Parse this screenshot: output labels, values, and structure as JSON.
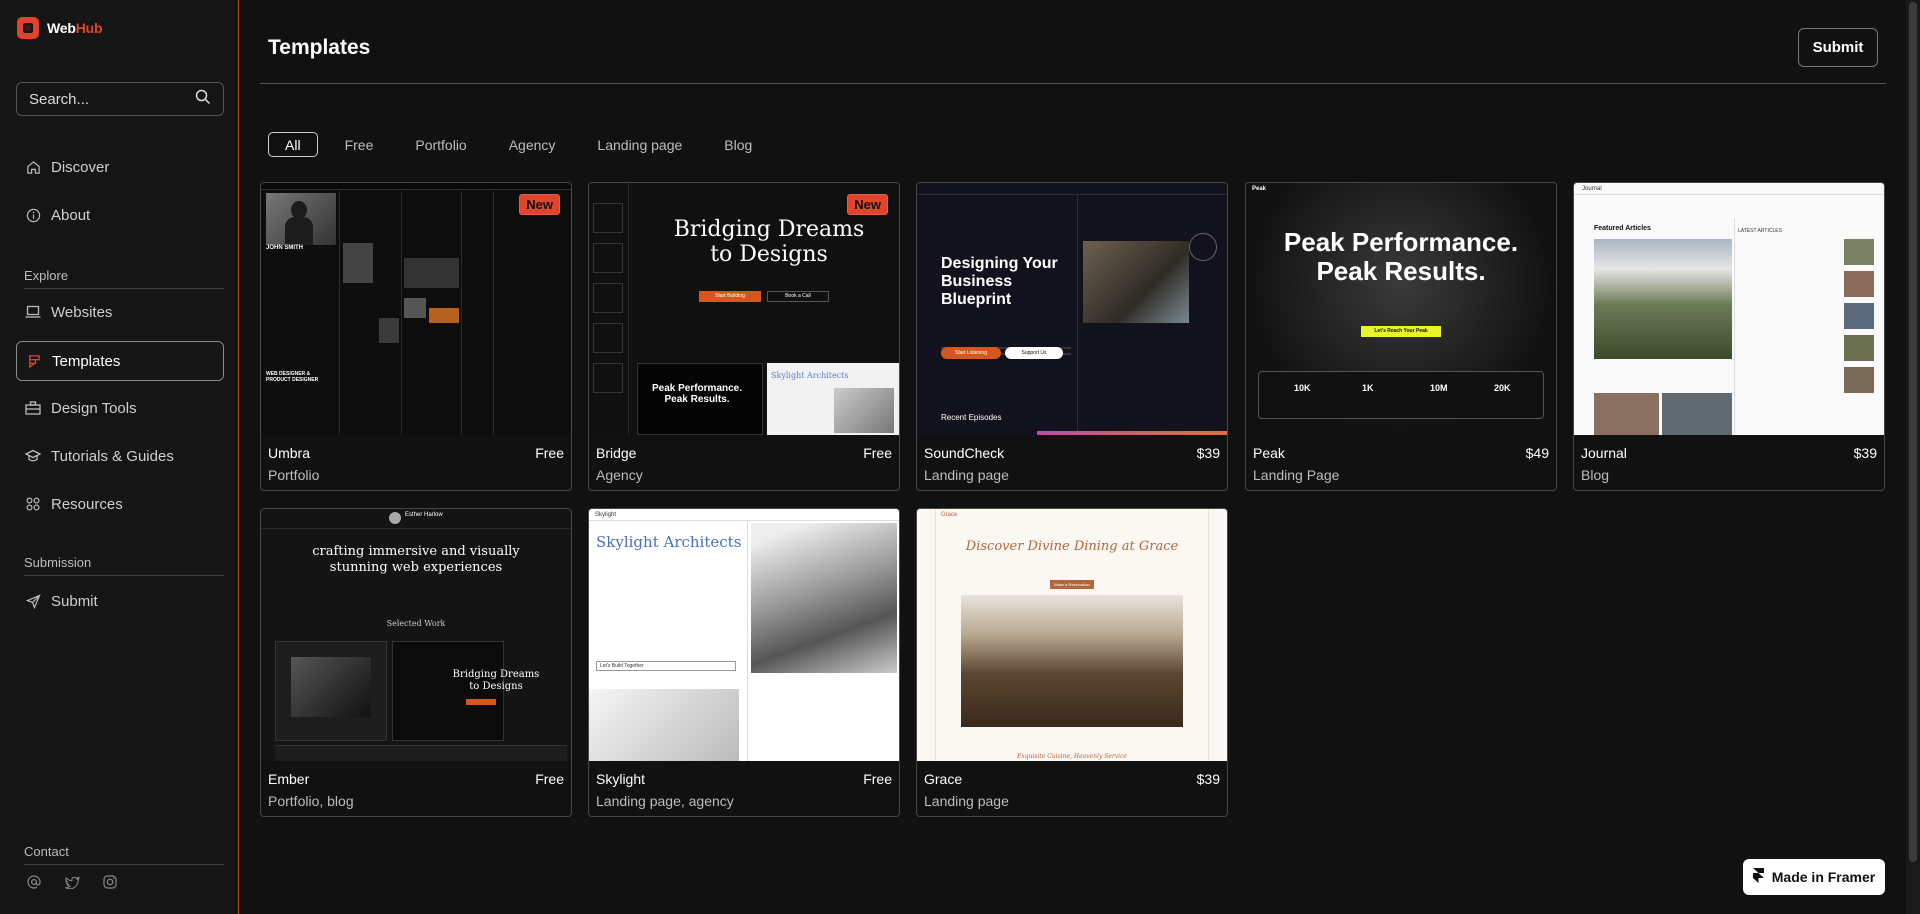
{
  "brand": {
    "name_a": "Web",
    "name_b": "Hub"
  },
  "search": {
    "placeholder": "Search..."
  },
  "nav": {
    "discover": "Discover",
    "about": "About",
    "explore_label": "Explore",
    "websites": "Websites",
    "templates": "Templates",
    "design_tools": "Design Tools",
    "tutorials": "Tutorials & Guides",
    "resources": "Resources",
    "submission_label": "Submission",
    "submit": "Submit",
    "contact_label": "Contact"
  },
  "header": {
    "title": "Templates",
    "submit_label": "Submit"
  },
  "filters": [
    "All",
    "Free",
    "Portfolio",
    "Agency",
    "Landing page",
    "Blog"
  ],
  "cards": [
    {
      "name": "Umbra",
      "price": "Free",
      "category": "Portfolio",
      "badge": "New"
    },
    {
      "name": "Bridge",
      "price": "Free",
      "category": "Agency",
      "badge": "New"
    },
    {
      "name": "SoundCheck",
      "price": "$39",
      "category": "Landing page"
    },
    {
      "name": "Peak",
      "price": "$49",
      "category": "Landing Page"
    },
    {
      "name": "Journal",
      "price": "$39",
      "category": "Blog"
    },
    {
      "name": "Ember",
      "price": "Free",
      "category": "Portfolio, blog"
    },
    {
      "name": "Skylight",
      "price": "Free",
      "category": "Landing page, agency"
    },
    {
      "name": "Grace",
      "price": "$39",
      "category": "Landing page"
    }
  ],
  "previews": {
    "umbra": {
      "person": "JOHN SMITH",
      "role": "WEB DESIGNER & PRODUCT DESIGNER"
    },
    "bridge": {
      "headline": "Bridging Dreams to Designs",
      "cta1": "Start Building",
      "cta2": "Book a Call",
      "sub": "Peak Performance. Peak Results.",
      "sub2": "Skylight Architects"
    },
    "soundcheck": {
      "headline": "Designing Your Business Blueprint",
      "cta1": "Start Listening",
      "cta2": "Support Us",
      "section": "Recent Episodes",
      "brand": "Peak"
    },
    "peak": {
      "brand": "Peak",
      "headline": "Peak Performance. Peak Results.",
      "cta": "Let's Reach Your Peak",
      "stats": [
        "10K",
        "1K",
        "10M",
        "20K"
      ]
    },
    "journal": {
      "brand": "Journal",
      "section": "Featured Articles",
      "aside": "LATEST ARTICLES"
    },
    "ember": {
      "name": "Esther Harlow",
      "headline": "crafting immersive and visually stunning web experiences",
      "section": "Selected Work",
      "inner": "Bridging Dreams to Designs"
    },
    "skylight": {
      "brand": "Skylight",
      "headline": "Skylight Architects",
      "cta": "Let's Build Together"
    },
    "grace": {
      "brand": "Grace",
      "headline": "Discover Divine Dining at Grace",
      "cta": "Make a Reservation",
      "footer": "Exquisite Cuisine, Heavenly Service"
    }
  },
  "framer": {
    "label": "Made in Framer"
  },
  "colors": {
    "accent": "#e0452c",
    "background": "#111111",
    "border": "#474747"
  }
}
